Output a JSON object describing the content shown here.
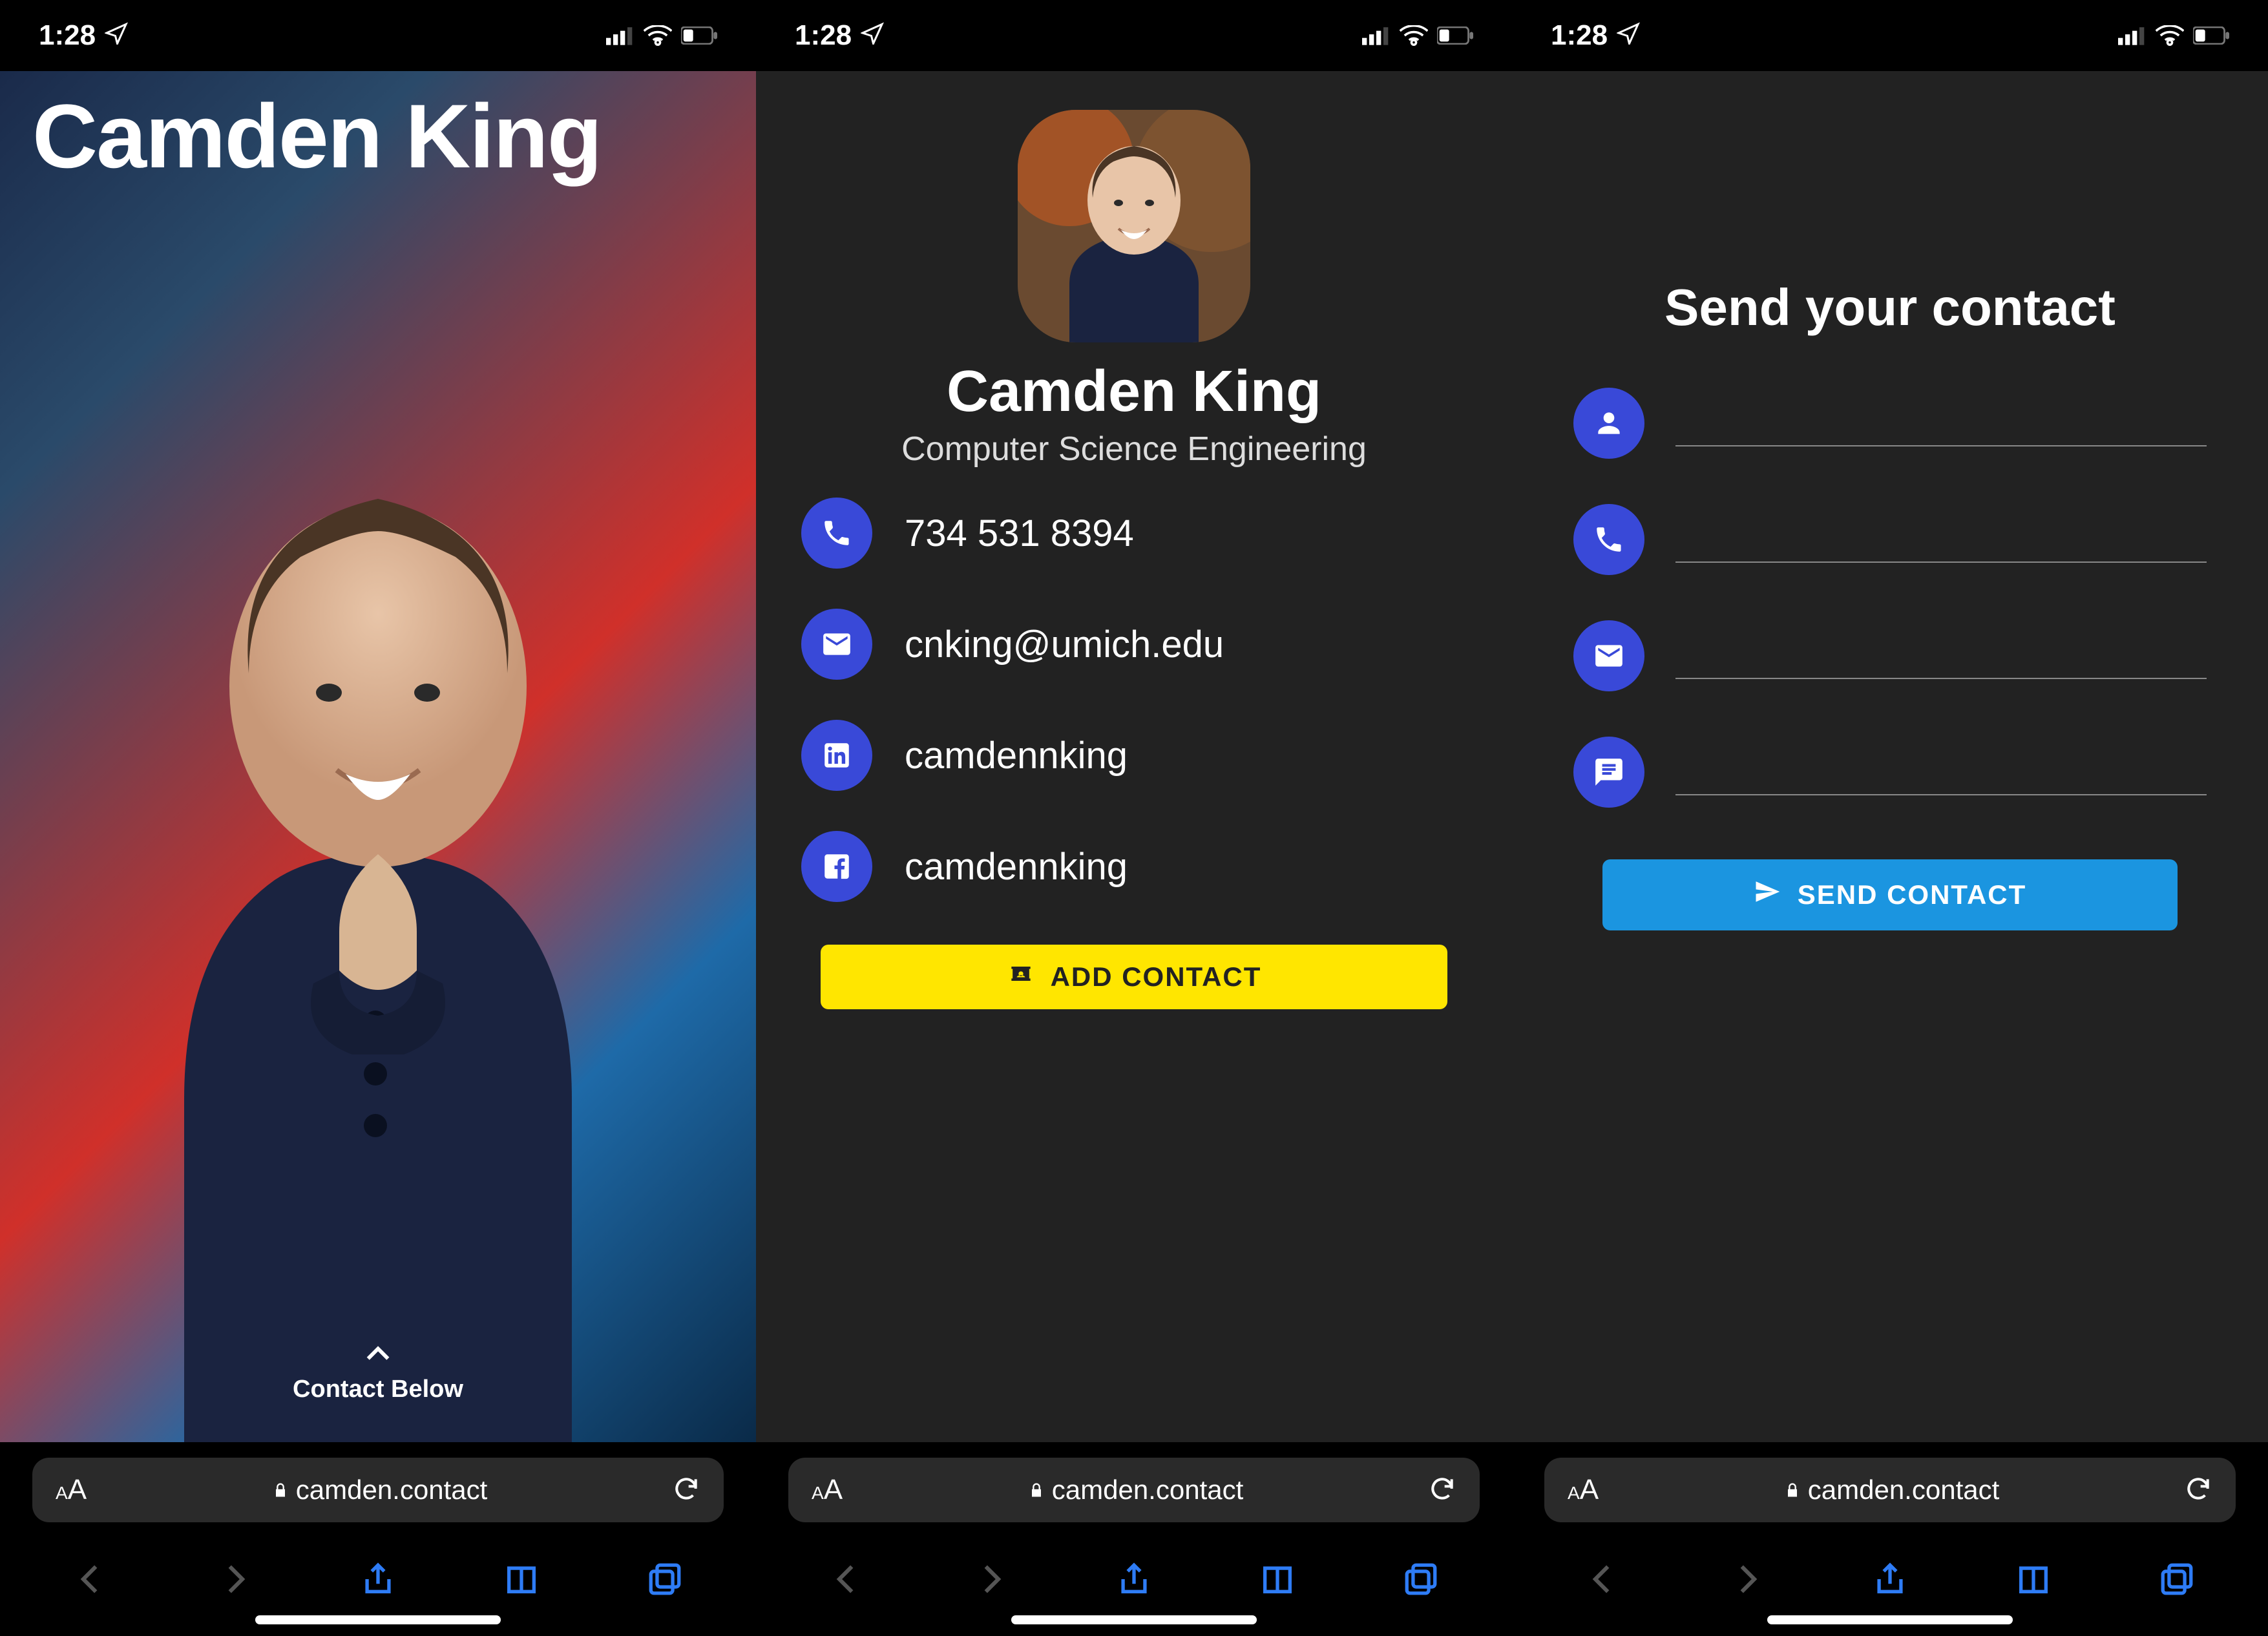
{
  "status": {
    "time": "1:28"
  },
  "url": "camden.contact",
  "screen1": {
    "title": "Camden King",
    "scroll_hint": "Contact Below"
  },
  "screen2": {
    "name": "Camden King",
    "subtitle": "Computer Science Engineering",
    "phone": "734 531 8394",
    "email": "cnking@umich.edu",
    "linkedin": "camdennking",
    "facebook": "camdennking",
    "add_label": "ADD CONTACT"
  },
  "screen3": {
    "title": "Send your contact",
    "send_label": "SEND CONTACT"
  }
}
